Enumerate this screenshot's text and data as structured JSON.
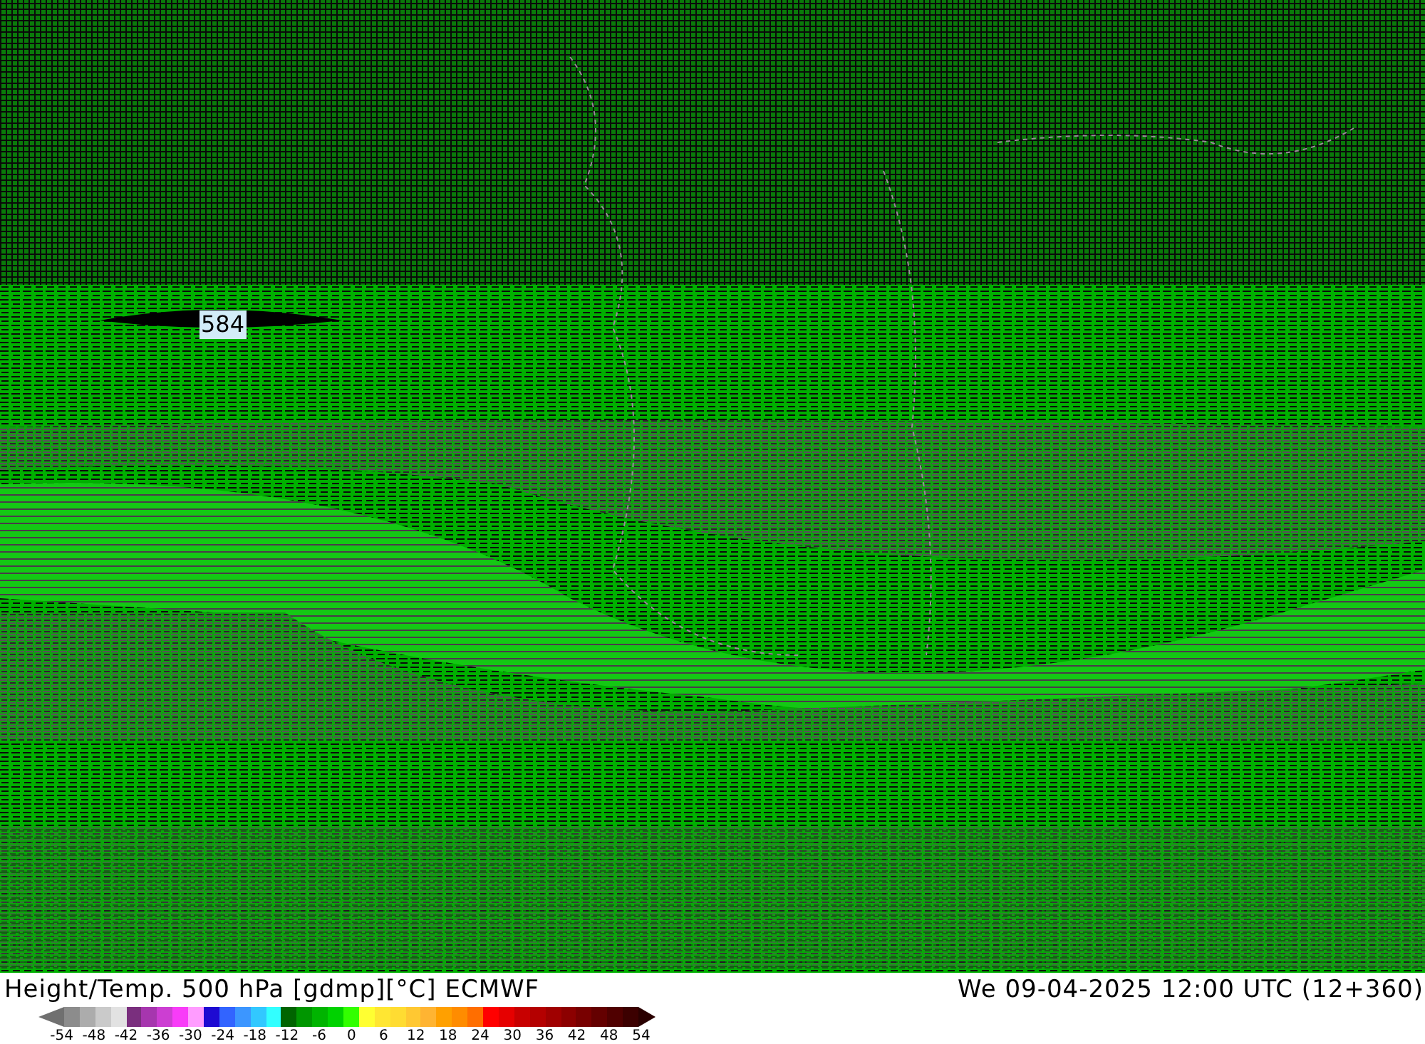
{
  "map": {
    "contour_label": "584"
  },
  "title": "Height/Temp. 500 hPa [gdmp][°C] ECMWF",
  "valid_time": "We 09-04-2025 12:00 UTC (12+360)",
  "legend": {
    "swatches": [
      {
        "kind": "below",
        "color": "#707070"
      },
      {
        "color": "#8c8c8c"
      },
      {
        "color": "#acacac"
      },
      {
        "color": "#cacaca"
      },
      {
        "color": "#e2e2e2"
      },
      {
        "color": "#7a2f7e"
      },
      {
        "color": "#a636ae"
      },
      {
        "color": "#cc3ed2"
      },
      {
        "color": "#f83cf8"
      },
      {
        "color": "#ff9cff"
      },
      {
        "color": "#1e0ad2"
      },
      {
        "color": "#3264ff"
      },
      {
        "color": "#3c96ff"
      },
      {
        "color": "#32c8ff"
      },
      {
        "color": "#32ffff"
      },
      {
        "color": "#006400"
      },
      {
        "color": "#009600"
      },
      {
        "color": "#00b400"
      },
      {
        "color": "#00d200"
      },
      {
        "color": "#32ff00"
      },
      {
        "color": "#ffff32"
      },
      {
        "color": "#ffe632"
      },
      {
        "color": "#ffdc32"
      },
      {
        "color": "#ffc832"
      },
      {
        "color": "#ffb432"
      },
      {
        "color": "#ffa000"
      },
      {
        "color": "#ff8c00"
      },
      {
        "color": "#ff6e00"
      },
      {
        "color": "#ff0000"
      },
      {
        "color": "#e60000"
      },
      {
        "color": "#c80000"
      },
      {
        "color": "#b40000"
      },
      {
        "color": "#a00000"
      },
      {
        "color": "#8c0000"
      },
      {
        "color": "#780000"
      },
      {
        "color": "#640000"
      },
      {
        "color": "#500000"
      },
      {
        "color": "#3c0000"
      },
      {
        "kind": "above",
        "color": "#2a0000"
      }
    ],
    "ticks": [
      "-54",
      "-48",
      "-42",
      "-36",
      "-30",
      "-24",
      "-18",
      "-12",
      "-6",
      "0",
      "6",
      "12",
      "18",
      "24",
      "30",
      "36",
      "42",
      "48",
      "54"
    ]
  }
}
